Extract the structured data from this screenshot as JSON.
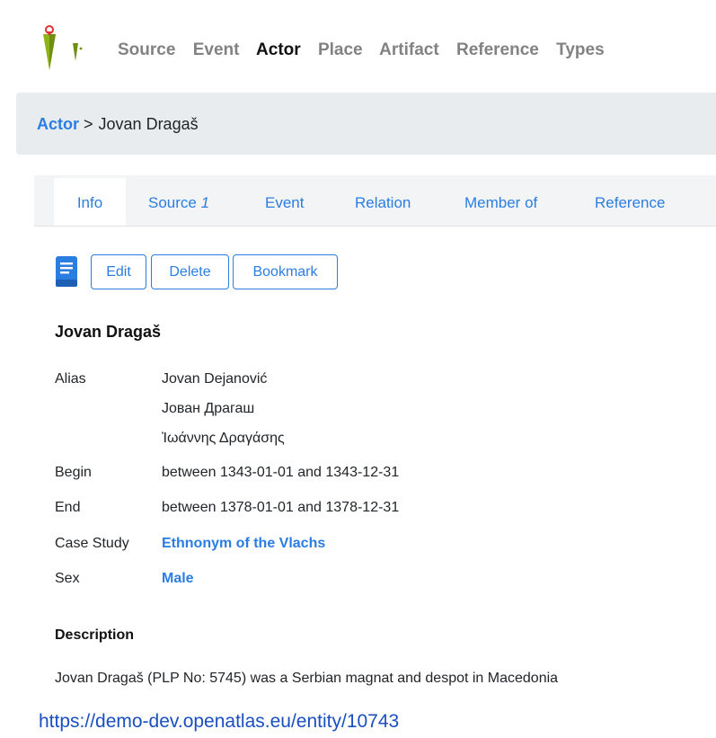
{
  "nav": {
    "items": [
      "Source",
      "Event",
      "Actor",
      "Place",
      "Artifact",
      "Reference",
      "Types"
    ],
    "active": "Actor"
  },
  "breadcrumb": {
    "parent": "Actor",
    "separator": ">",
    "current": "Jovan Dragaš"
  },
  "tabs": {
    "info": "Info",
    "source": "Source",
    "source_count": "1",
    "event": "Event",
    "relation": "Relation",
    "member_of": "Member of",
    "reference": "Reference"
  },
  "toolbar": {
    "edit": "Edit",
    "delete": "Delete",
    "bookmark": "Bookmark"
  },
  "entity": {
    "title": "Jovan Dragaš",
    "fields": {
      "alias_label": "Alias",
      "aliases": [
        "Jovan Dejanović",
        "Јован Драгаш",
        "Ἰωάννης Δραγάσης"
      ],
      "begin_label": "Begin",
      "begin_value": "between 1343-01-01 and 1343-12-31",
      "end_label": "End",
      "end_value": "between 1378-01-01 and 1378-12-31",
      "case_study_label": "Case Study",
      "case_study_value": "Ethnonym of the Vlachs",
      "sex_label": "Sex",
      "sex_value": "Male"
    }
  },
  "description": {
    "heading": "Description",
    "text": "Jovan Dragaš (PLP No: 5745) was a Serbian magnat and despot in Macedonia"
  },
  "footer_url": "https://demo-dev.openatlas.eu/entity/10743",
  "colors": {
    "link": "#2a7de1",
    "nav_muted": "#828282",
    "breadcrumb_bg": "#e9ecef",
    "logo_green": "#8fb31a"
  }
}
